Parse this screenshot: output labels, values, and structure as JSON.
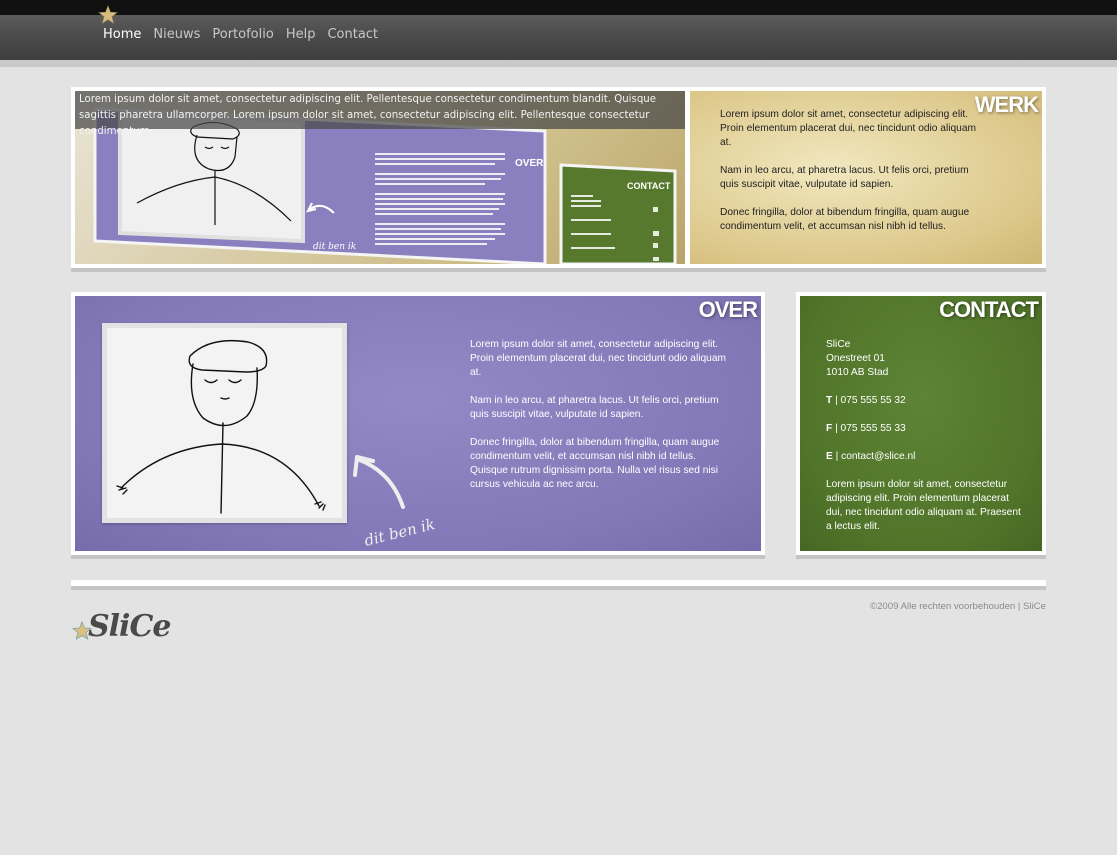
{
  "nav": {
    "items": [
      {
        "label": "Home",
        "active": true
      },
      {
        "label": "Nieuws"
      },
      {
        "label": "Portofolio"
      },
      {
        "label": "Help"
      },
      {
        "label": "Contact"
      }
    ]
  },
  "slider": {
    "caption": "Lorem ipsum dolor sit amet, consectetur adipiscing elit. Pellentesque consectetur condimentum blandit. Quisque sagittis pharetra ullamcorper. Lorem ipsum dolor sit amet, consectetur adipiscing elit. Pellentesque consectetur condimentum.",
    "thumb": {
      "over_heading": "OVER",
      "contact_heading": "CONTACT",
      "handwriting": "dit ben ik"
    }
  },
  "werk": {
    "heading": "WERK",
    "paragraphs": [
      "Lorem ipsum dolor sit amet, consectetur adipiscing elit. Proin elementum placerat dui, nec tincidunt odio aliquam at.",
      "Nam in leo arcu, at pharetra lacus. Ut felis orci, pretium quis suscipit vitae, vulputate id sapien.",
      "Donec fringilla, dolor at bibendum fringilla, quam augue condimentum velit, et accumsan nisl nibh id tellus."
    ]
  },
  "over": {
    "heading": "OVER",
    "handwriting": "dit ben ik",
    "paragraphs": [
      "Lorem ipsum dolor sit amet, consectetur adipiscing elit. Proin elementum placerat dui, nec tincidunt odio aliquam at.",
      "Nam in leo arcu, at pharetra lacus. Ut felis orci, pretium quis suscipit vitae, vulputate id sapien.",
      "Donec fringilla, dolor at bibendum fringilla, quam augue condimentum velit, et accumsan nisl nibh id tellus. Quisque rutrum dignissim porta. Nulla vel risus sed nisi cursus vehicula ac nec arcu."
    ]
  },
  "contact": {
    "heading": "CONTACT",
    "company": "SliCe",
    "street": "Onestreet 01",
    "city": "1010 AB Stad",
    "phone_label": "T",
    "phone": "075 555 55 32",
    "fax_label": "F",
    "fax": "075 555 55 33",
    "email_label": "E",
    "email": "contact@slice.nl",
    "note": "Lorem ipsum dolor sit amet, consectetur adipiscing elit. Proin elementum placerat dui, nec tincidunt odio aliquam at. Praesent a lectus elit."
  },
  "footer": {
    "logo_text": "SliCe",
    "copyright": "©2009 Alle rechten voorbehouden | SliCe"
  },
  "colors": {
    "over_bg": "#8378b7",
    "contact_bg": "#507429",
    "werk_bg": "#dcc88a",
    "nav_bg": "#4a4a4a"
  },
  "icons": [
    "star-icon",
    "arrow-icon"
  ]
}
